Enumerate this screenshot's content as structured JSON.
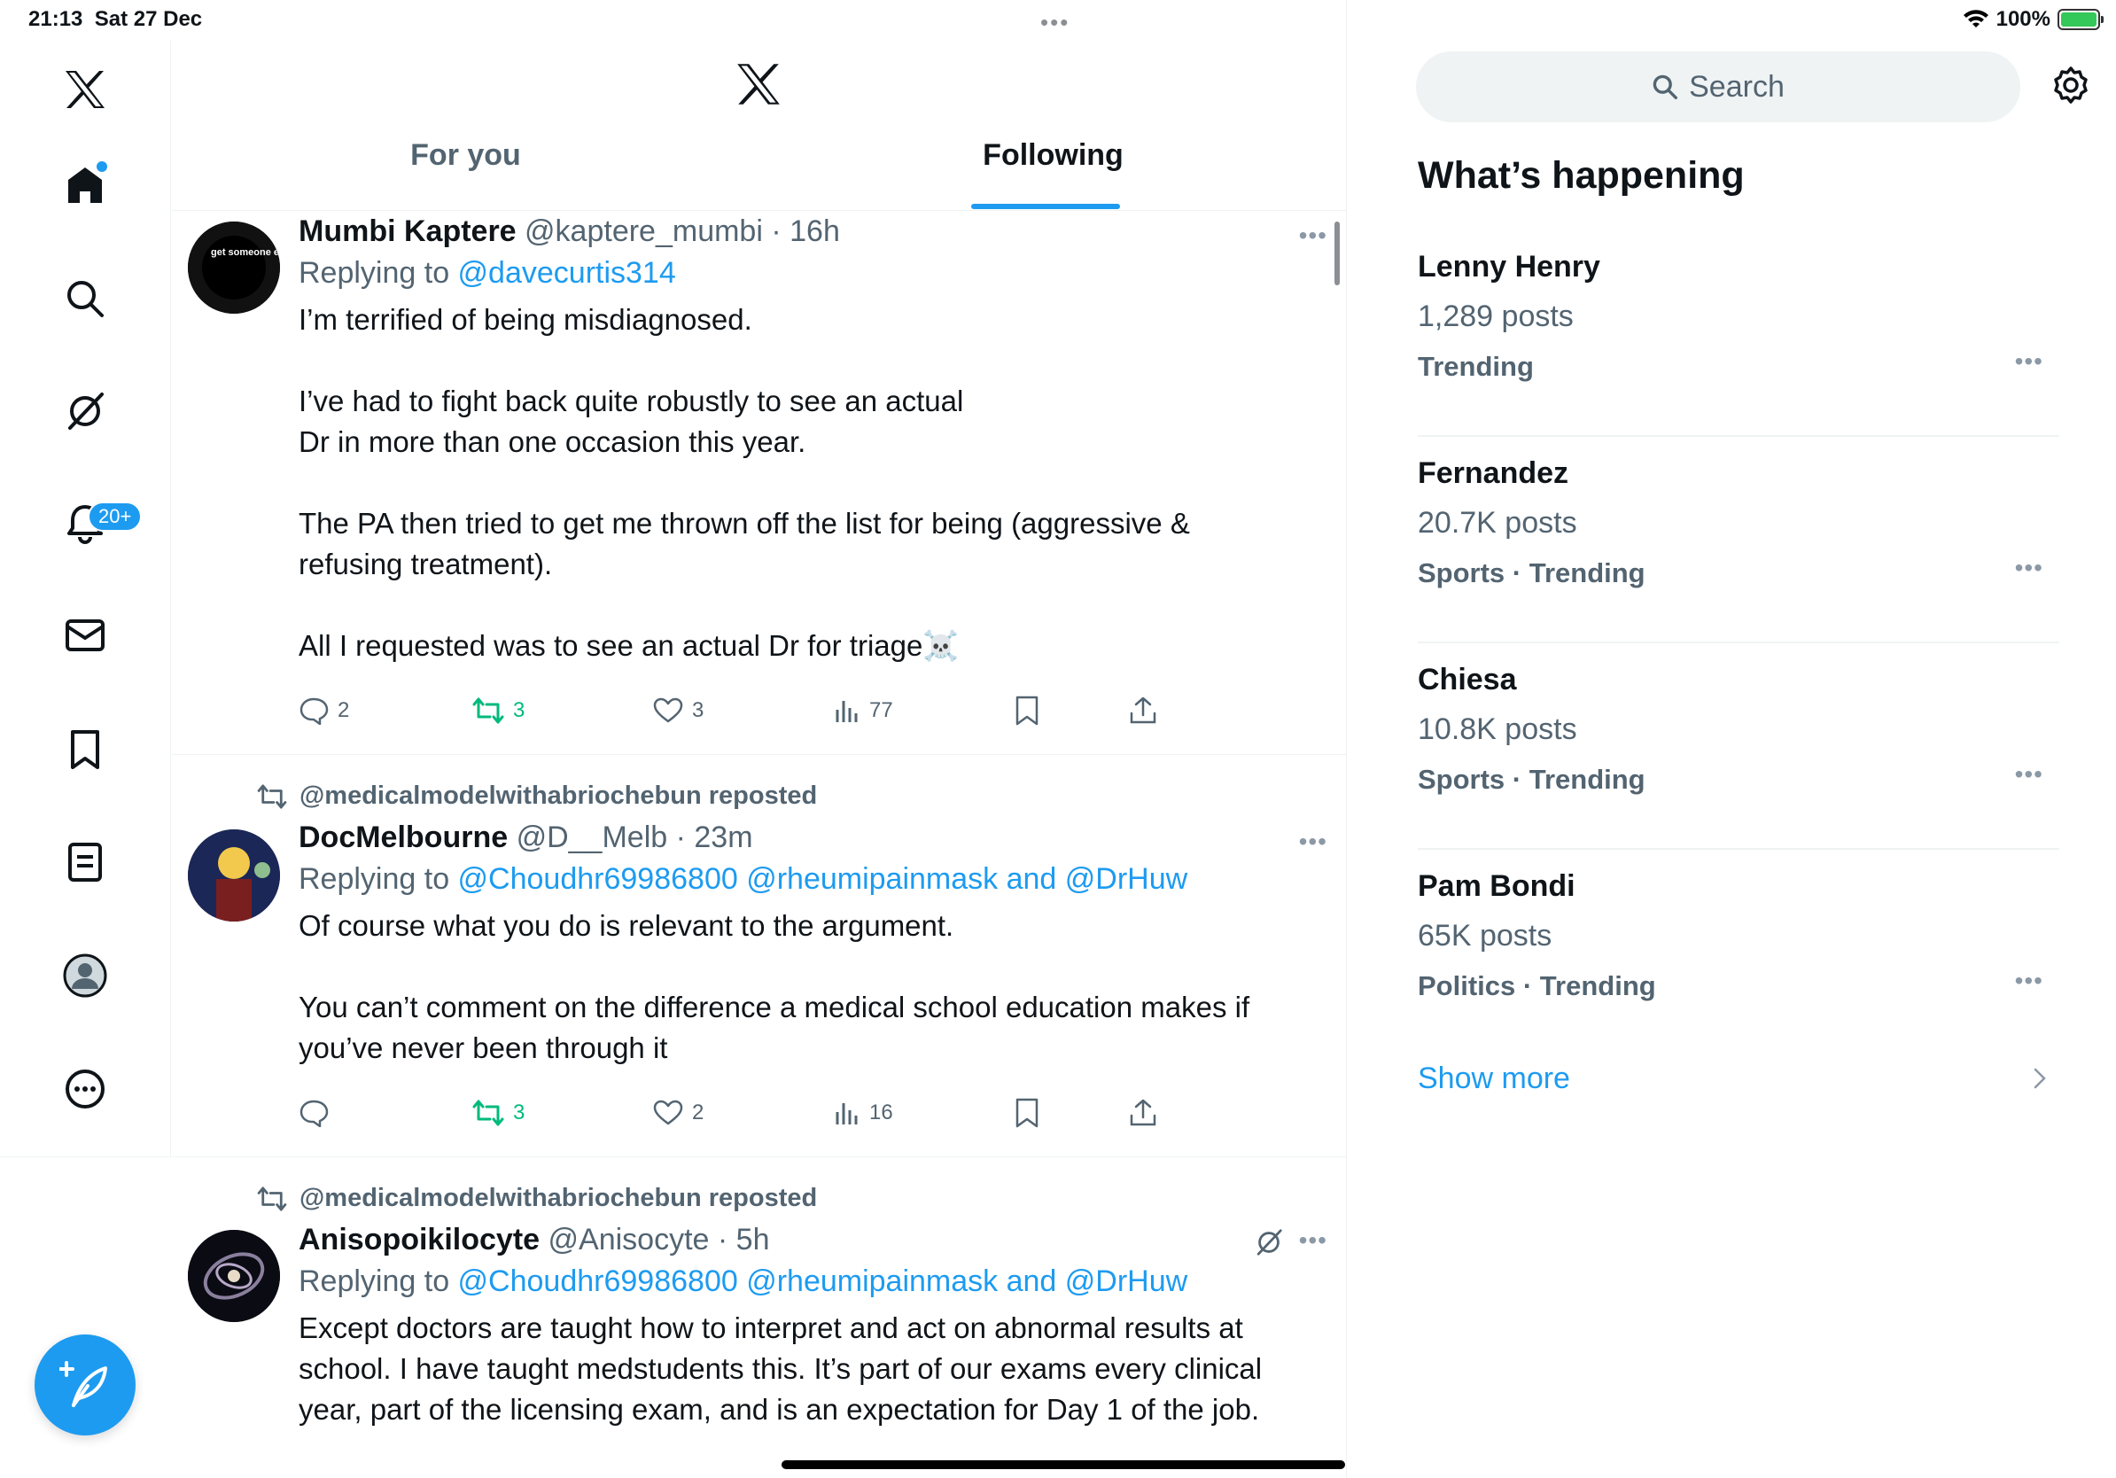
{
  "status": {
    "time": "21:13",
    "date": "Sat 27 Dec",
    "battery": "100%"
  },
  "nav": {
    "notifications_badge": "20+"
  },
  "tabs": {
    "for_you": "For you",
    "following": "Following"
  },
  "posts": [
    {
      "repost_by": "",
      "name": "Mumbi Kaptere",
      "handle": "@kaptere_mumbi",
      "time": "16h",
      "replying_prefix": "Replying to ",
      "replying_to": "@davecurtis314",
      "text": "I’m terrified of being misdiagnosed.\n\nI’ve had to fight back quite robustly to see an actual\nDr in more than one occasion this year.\n\nThe PA then tried to get me thrown off the list for being (aggressive &\nrefusing treatment).\n\nAll I requested was to see an actual Dr for triage☠️",
      "replies": "2",
      "reposts": "3",
      "likes": "3",
      "views": "77",
      "avatar_text": "get someone else to do it."
    },
    {
      "repost_by": "@medicalmodelwithabriochebun reposted",
      "name": "DocMelbourne",
      "handle": "@D__Melb",
      "time": "23m",
      "replying_prefix": "Replying to ",
      "replying_to": "@Choudhr69986800 @rheumipainmask and @DrHuw",
      "text": "Of course what you do is relevant to the argument.\n\nYou can’t comment on the difference a medical school education makes if\nyou’ve never been through it",
      "replies": "",
      "reposts": "3",
      "likes": "2",
      "views": "16"
    },
    {
      "repost_by": "@medicalmodelwithabriochebun reposted",
      "name": "Anisopoikilocyte",
      "handle": "@Anisocyte",
      "time": "5h",
      "replying_prefix": "Replying to ",
      "replying_to": "@Choudhr69986800 @rheumipainmask and @DrHuw",
      "text": "Except doctors are taught how to interpret and act on abnormal results at\nschool. I have taught medstudents this. It’s part of our exams every clinical\nyear, part of the licensing exam, and is an expectation for Day 1 of the job."
    }
  ],
  "sidebar": {
    "search_placeholder": "Search",
    "heading": "What’s happening",
    "trends": [
      {
        "name": "Lenny Henry",
        "count": "1,289 posts",
        "meta": "Trending"
      },
      {
        "name": "Fernandez",
        "count": "20.7K posts",
        "meta": "Sports · Trending"
      },
      {
        "name": "Chiesa",
        "count": "10.8K posts",
        "meta": "Sports · Trending"
      },
      {
        "name": "Pam Bondi",
        "count": "65K posts",
        "meta": "Politics · Trending"
      }
    ],
    "show_more": "Show more"
  },
  "colors": {
    "accent": "#1d9bf0",
    "repost_green": "#00ba7c",
    "secondary_text": "#536471"
  }
}
